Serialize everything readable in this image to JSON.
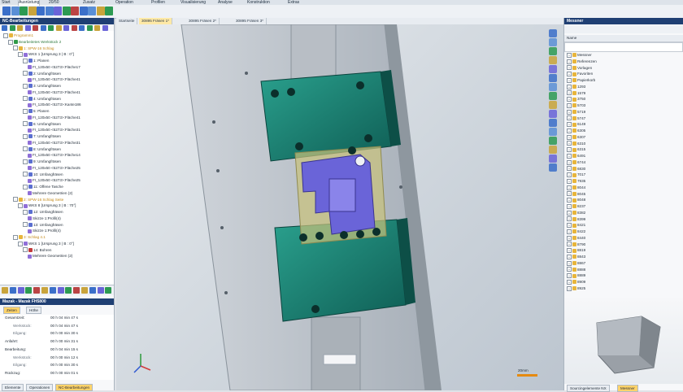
{
  "menubar": {
    "items": [
      "Start",
      "Ausrüstung",
      "20/50",
      "Zusatz",
      "Operation",
      "Profilen",
      "Visualisierung",
      "Analyse",
      "Konstruktion",
      "Extras"
    ],
    "active_index": 1
  },
  "left_panel": {
    "title": "NC-Bearbeitungen",
    "tree": [
      {
        "level": 0,
        "exp": "-",
        "icon": "folder",
        "text": "Programm1"
      },
      {
        "level": 1,
        "exp": "-",
        "icon": "green",
        "text": "Bearbeitetes Werkstück 2"
      },
      {
        "level": 2,
        "exp": "-",
        "icon": "folder",
        "text": "1: SPW-16 Schlag"
      },
      {
        "level": 3,
        "exp": "-",
        "icon": "geo",
        "text": "WKS 1 [Ursprung 3 | B : 0°]"
      },
      {
        "level": 4,
        "exp": "-",
        "icon": "op",
        "text": "1: Planen"
      },
      {
        "level": 5,
        "exp": "",
        "icon": "geo",
        "text": "FI_120x50 <5273>:Fläche17"
      },
      {
        "level": 4,
        "exp": "-",
        "icon": "op",
        "text": "2: Umfangfräsen"
      },
      {
        "level": 5,
        "exp": "",
        "icon": "geo",
        "text": "FI_120x50 <5273>:Fläche41"
      },
      {
        "level": 4,
        "exp": "-",
        "icon": "op",
        "text": "3: Umfangfräsen"
      },
      {
        "level": 5,
        "exp": "",
        "icon": "geo",
        "text": "FI_120x50 <5273>:Fläche41"
      },
      {
        "level": 4,
        "exp": "-",
        "icon": "op",
        "text": "4: Umfangfräsen"
      },
      {
        "level": 5,
        "exp": "",
        "icon": "geo",
        "text": "FI_120x50 <5273>:Kante186"
      },
      {
        "level": 4,
        "exp": "-",
        "icon": "op",
        "text": "5: Planen"
      },
      {
        "level": 5,
        "exp": "",
        "icon": "geo",
        "text": "FI_120x50 <5273>:Fläche41"
      },
      {
        "level": 4,
        "exp": "-",
        "icon": "op",
        "text": "6: Umfangfräsen"
      },
      {
        "level": 5,
        "exp": "",
        "icon": "geo",
        "text": "FI_120x50 <5273>:Fläche31"
      },
      {
        "level": 4,
        "exp": "-",
        "icon": "op",
        "text": "7: Umfangfräsen"
      },
      {
        "level": 5,
        "exp": "",
        "icon": "geo",
        "text": "FI_120x50 <5273>:Fläche31"
      },
      {
        "level": 4,
        "exp": "-",
        "icon": "op",
        "text": "8: Umfangfräsen"
      },
      {
        "level": 5,
        "exp": "",
        "icon": "geo",
        "text": "FI_120x50 <5273>:Fläche14"
      },
      {
        "level": 4,
        "exp": "-",
        "icon": "op",
        "text": "9: Umfangfräsen"
      },
      {
        "level": 5,
        "exp": "",
        "icon": "geo",
        "text": "FI_120x50 <5273>:Fläche25"
      },
      {
        "level": 4,
        "exp": "-",
        "icon": "op",
        "text": "10: Umfangfräsen"
      },
      {
        "level": 5,
        "exp": "",
        "icon": "geo",
        "text": "FI_120x50 <5273>:Fläche25"
      },
      {
        "level": 4,
        "exp": "-",
        "icon": "op",
        "text": "11: Offene Tasche"
      },
      {
        "level": 5,
        "exp": "",
        "icon": "geo",
        "text": "Mehrere Geometrien (2)"
      },
      {
        "level": 2,
        "exp": "-",
        "icon": "folder",
        "text": "2: SPW-16 Schlag Seite"
      },
      {
        "level": 3,
        "exp": "-",
        "icon": "geo",
        "text": "WKS 8 [Ursprung 3 | B : 70°]"
      },
      {
        "level": 4,
        "exp": "-",
        "icon": "op",
        "text": "12: Umfangfräsen"
      },
      {
        "level": 5,
        "exp": "",
        "icon": "geo",
        "text": "Skizze 1:Profil(4)"
      },
      {
        "level": 4,
        "exp": "-",
        "icon": "op",
        "text": "13: Umfangfräsen"
      },
      {
        "level": 5,
        "exp": "",
        "icon": "geo",
        "text": "Skizze 1:Profil(4)"
      },
      {
        "level": 2,
        "exp": "-",
        "icon": "folder",
        "text": "3: Schlag 4.1"
      },
      {
        "level": 3,
        "exp": "-",
        "icon": "geo",
        "text": "WKS 1 [Ursprung 3 | B : 0°]"
      },
      {
        "level": 4,
        "exp": "-",
        "icon": "red",
        "text": "14: Bohren"
      },
      {
        "level": 5,
        "exp": "",
        "icon": "geo",
        "text": "Mehrere Geometrien (2)"
      }
    ],
    "machine_title": "Mazak - Mazak FH5800",
    "tabs": [
      "Zeiten",
      "Höhe"
    ],
    "times": [
      {
        "label": "Gesamtzeit:",
        "value": "00 h 04 min 47 s",
        "indent": false
      },
      {
        "label": "Werkstück:",
        "value": "00 h 04 min 47 s",
        "indent": true
      },
      {
        "label": "Eilgang:",
        "value": "00 h 00 min 30 s",
        "indent": true
      },
      {
        "label": "Anfahrt:",
        "value": "00 h 00 min 31 s",
        "indent": false
      },
      {
        "label": "Bearbeitung:",
        "value": "00 h 04 min 15 s",
        "indent": false
      },
      {
        "label": "Werkstück:",
        "value": "00 h 00 min 12 s",
        "indent": true
      },
      {
        "label": "Eilgang:",
        "value": "00 h 00 min 30 s",
        "indent": true
      },
      {
        "label": "Rückzug:",
        "value": "00 h 00 min 01 s",
        "indent": false
      }
    ],
    "bottom_tabs": [
      "Elemente",
      "Operationen",
      "NC-Bearbeitungen"
    ],
    "bottom_active": 2
  },
  "viewport": {
    "tabs": [
      "Startseite",
      "30895 Fräsen 1*",
      "30895 Fräsen 2*",
      "30895 Fräsen 3*"
    ],
    "active_tab": 1,
    "scale_label": "20mm",
    "colors": {
      "fixture": "#1f8a7a",
      "fixture_dark": "#0f5e55",
      "part": "#6a64d8",
      "stock": "#c9c27a"
    }
  },
  "right_panel": {
    "title": "Messner",
    "column_header": "Name",
    "items": [
      "Messner",
      "Referenzen",
      "Vorlagen",
      "Favoriten",
      "Papierkorb",
      "1293",
      "1579",
      "3750",
      "5703",
      "5719",
      "5747",
      "6149",
      "6305",
      "6307",
      "6310",
      "6315",
      "6491",
      "6744",
      "6830",
      "7017",
      "7935",
      "8044",
      "8045",
      "8048",
      "8237",
      "8382",
      "8399",
      "8421",
      "8422",
      "8440",
      "8790",
      "8819",
      "8843",
      "8867",
      "8888",
      "8889",
      "8909",
      "8925"
    ],
    "bottom_tabs": [
      "Sourcingelemente NX",
      "Messner"
    ],
    "bottom_active": 1
  }
}
